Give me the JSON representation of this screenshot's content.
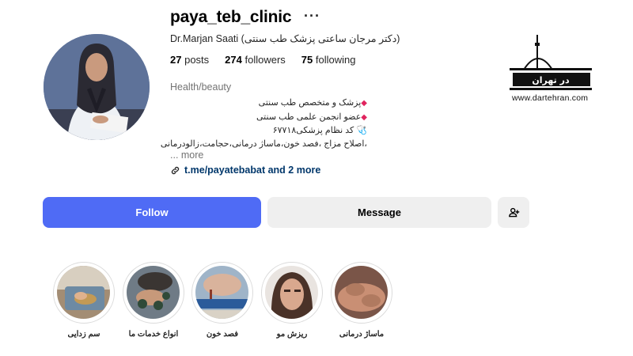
{
  "profile": {
    "username": "paya_teb_clinic",
    "options_icon": "ellipsis-icon",
    "full_name": "Dr.Marjan Saati (دکتر مرجان ساعتی پزشک طب سنتی)",
    "stats": {
      "posts": "27",
      "posts_label": "posts",
      "followers": "274",
      "followers_label": "followers",
      "following": "75",
      "following_label": "following"
    },
    "category": "Health/beauty",
    "bio": [
      "پزشک و متخصص طب سنتی",
      "عضو انجمن علمی طب سنتی",
      "کد نظام پزشکی۶۷۷۱۸",
      "،اصلاح مزاج ،فصد خون،ماساژ درمانی،حجامت،زالودرمانی"
    ],
    "bio_more": "... more",
    "link_text": "t.me/payatebabat and 2 more",
    "link_icon": "link-icon"
  },
  "buttons": {
    "follow": "Follow",
    "message": "Message",
    "add_user_icon": "add-person-icon"
  },
  "highlights": [
    {
      "label": "سم زدایی"
    },
    {
      "label": "انواع خدمات ما"
    },
    {
      "label": "فصد خون"
    },
    {
      "label": "ریزش مو"
    },
    {
      "label": "ماساژ درمانی"
    }
  ],
  "watermark": {
    "logo_text": "در تهران",
    "url": "www.dartehran.com"
  },
  "colors": {
    "accent": "#4f6bf5",
    "secondary_button": "#efefef",
    "link": "#00376b",
    "muted": "#737373",
    "bio_diamond": "#e0245e"
  }
}
